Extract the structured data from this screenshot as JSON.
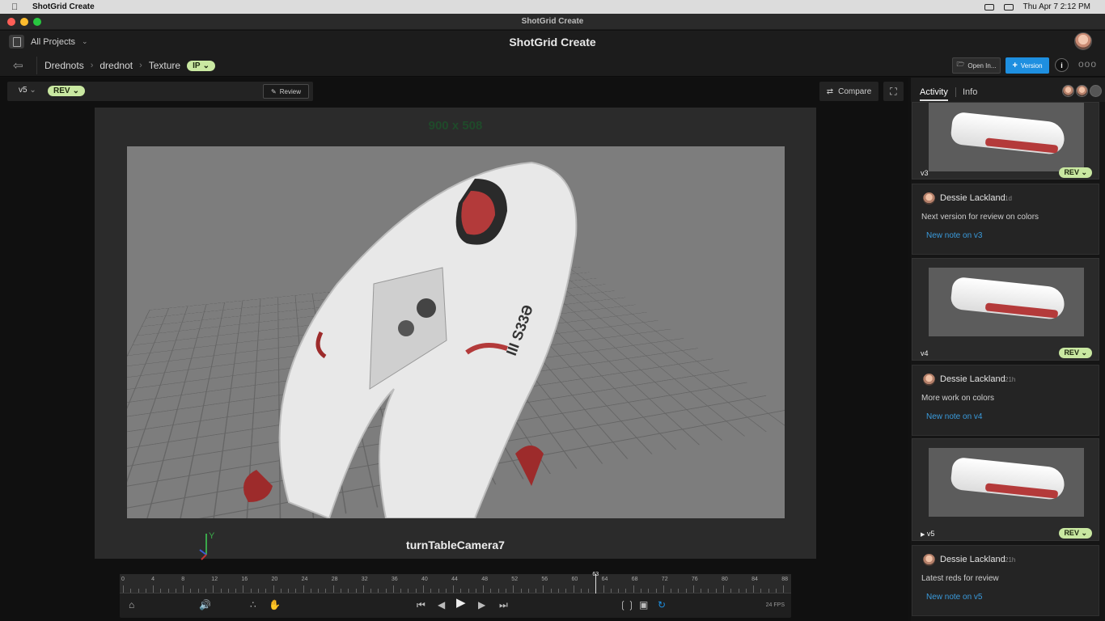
{
  "menubar": {
    "app_name": "ShotGrid Create",
    "date_time": "Thu Apr 7  2:12 PM"
  },
  "window": {
    "title": "ShotGrid Create"
  },
  "header": {
    "projects_label": "All Projects",
    "app_title": "ShotGrid Create"
  },
  "breadcrumb": {
    "items": [
      "Drednots",
      "drednot",
      "Texture"
    ],
    "status": "IP"
  },
  "actions": {
    "open_label": "Open In...",
    "version_label": "Version",
    "info_label": "i",
    "more_label": "ooo"
  },
  "viewer": {
    "version": "v5",
    "status": "REV",
    "review_label": "Review",
    "compare_label": "Compare",
    "resolution": "900 x 508",
    "camera": "turnTableCamera7",
    "axis_label": "Y"
  },
  "timeline": {
    "ticks": [
      "0",
      "4",
      "8",
      "12",
      "16",
      "20",
      "24",
      "28",
      "32",
      "36",
      "40",
      "44",
      "48",
      "52",
      "56",
      "60",
      "64",
      "68",
      "72",
      "76",
      "80",
      "84",
      "88"
    ],
    "current_frame": "63",
    "fps": "24 FPS"
  },
  "panel": {
    "tabs": [
      "Activity",
      "Info"
    ],
    "activity": [
      {
        "version": "v3",
        "status": "REV",
        "author": "Dessie Lackland",
        "age": "1d",
        "note": "Next version for review on colors",
        "link": "New note on v3"
      },
      {
        "version": "v4",
        "status": "REV",
        "author": "Dessie Lackland",
        "age": "21h",
        "note": "More work on colors",
        "link": "New note on v4"
      },
      {
        "version": "v5",
        "status": "REV",
        "author": "Dessie Lackland",
        "age": "21h",
        "note": "Latest reds for review",
        "link": "New note on v5"
      }
    ]
  },
  "colors": {
    "accent_blue": "#1e8fe0",
    "status_green": "#c9e8a1",
    "link_blue": "#3a9bdc"
  }
}
